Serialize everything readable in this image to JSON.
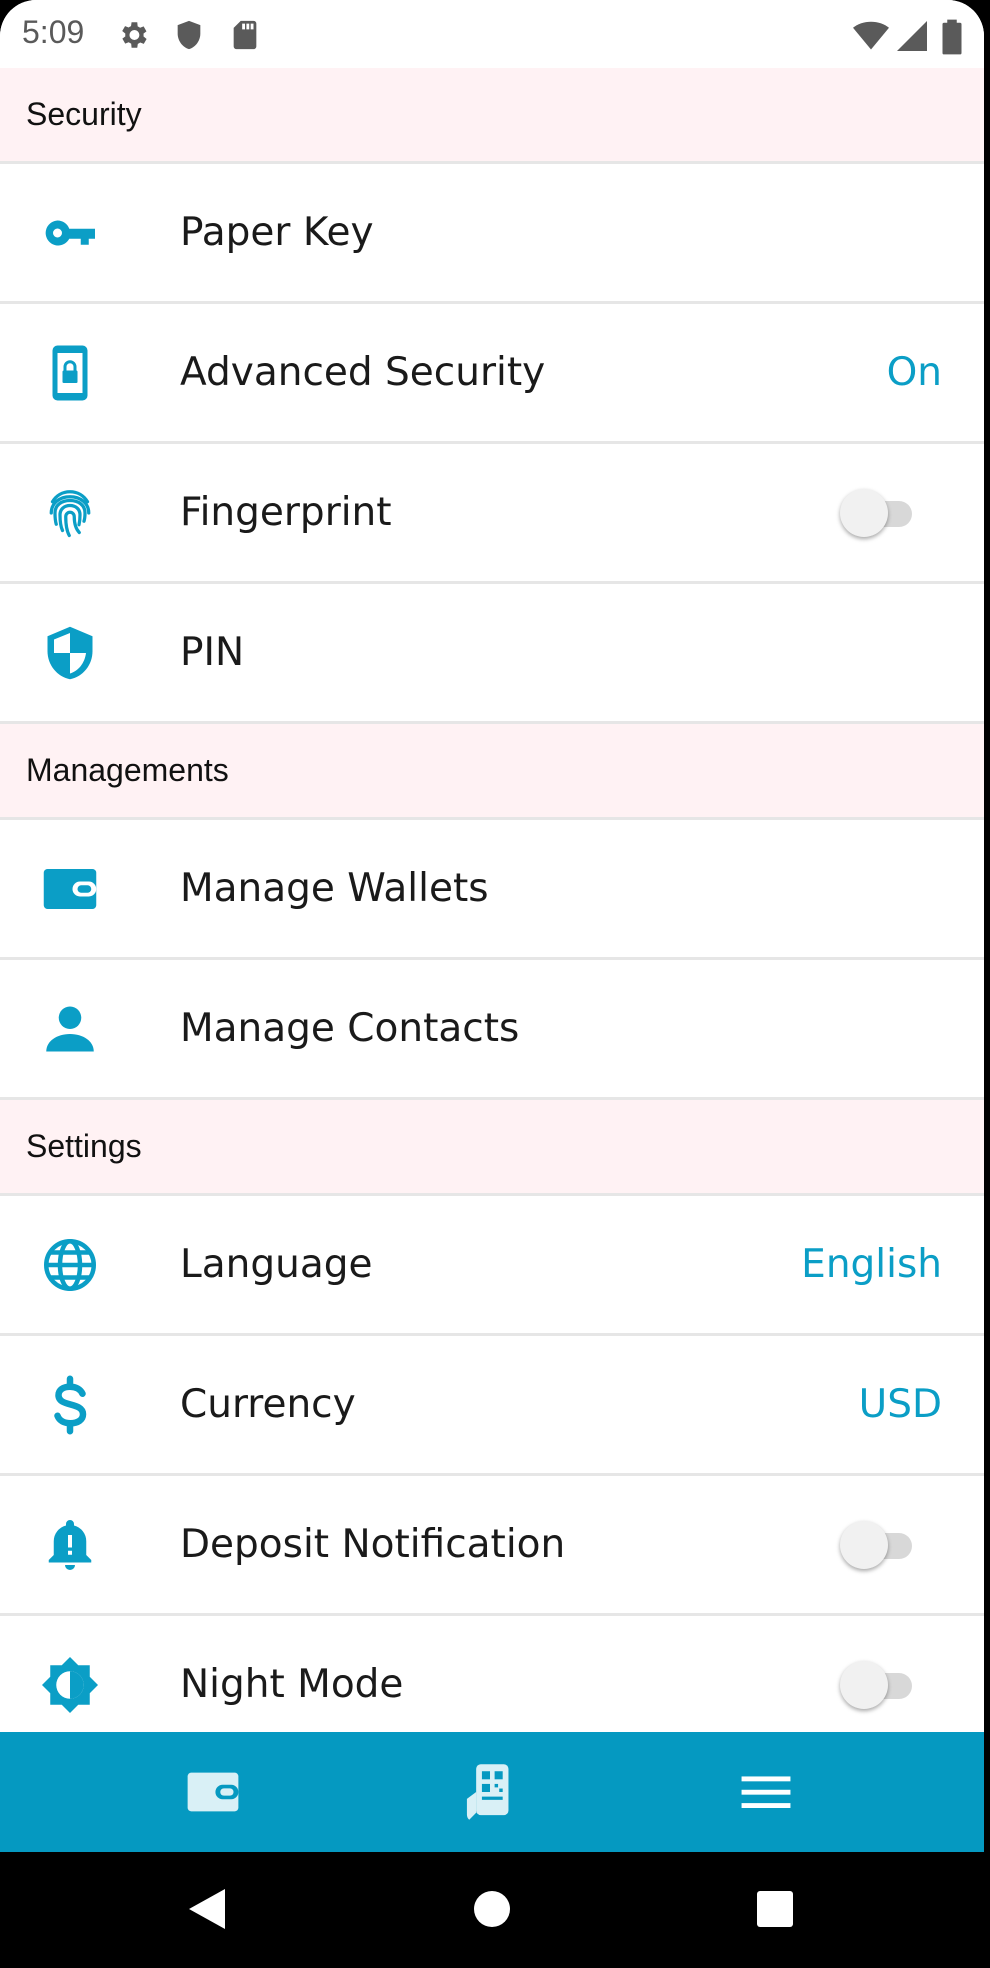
{
  "status_bar": {
    "time": "5:09",
    "left_icons": [
      "gear-icon",
      "shield-icon",
      "sd-card-icon"
    ],
    "right_icons": [
      "wifi-icon",
      "cell-signal-icon",
      "battery-icon"
    ]
  },
  "sections": {
    "security": {
      "title": "Security",
      "items": [
        {
          "label": "Paper Key",
          "icon": "key-icon"
        },
        {
          "label": "Advanced Security",
          "icon": "phone-lock-icon",
          "value": "On"
        },
        {
          "label": "Fingerprint",
          "icon": "fingerprint-icon",
          "toggle": false
        },
        {
          "label": "PIN",
          "icon": "shield-check-icon"
        }
      ]
    },
    "managements": {
      "title": "Managements",
      "items": [
        {
          "label": "Manage Wallets",
          "icon": "wallet-icon"
        },
        {
          "label": "Manage Contacts",
          "icon": "person-icon"
        }
      ]
    },
    "settings": {
      "title": "Settings",
      "items": [
        {
          "label": "Language",
          "icon": "globe-icon",
          "value": "English"
        },
        {
          "label": "Currency",
          "icon": "dollar-icon",
          "value": "USD"
        },
        {
          "label": "Deposit Notification",
          "icon": "bell-alert-icon",
          "toggle": false
        },
        {
          "label": "Night Mode",
          "icon": "brightness-icon",
          "toggle": false
        }
      ]
    }
  },
  "tabbar": {
    "tabs": [
      {
        "icon": "wallet-icon"
      },
      {
        "icon": "qr-phone-icon"
      },
      {
        "icon": "menu-icon"
      }
    ]
  },
  "navbar": {
    "buttons": [
      "back-icon",
      "home-icon",
      "recents-icon"
    ]
  },
  "colors": {
    "accent": "#0599c1",
    "value_text": "#0b9ec6",
    "section_bg": "#fff2f4",
    "divider": "#e6e6e6"
  }
}
